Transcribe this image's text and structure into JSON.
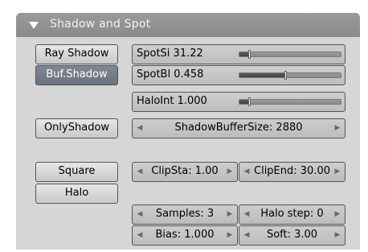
{
  "panel": {
    "title": "Shadow and Spot"
  },
  "buttons": {
    "ray_shadow": "Ray Shadow",
    "buf_shadow": "Buf.Shadow",
    "only_shadow": "OnlyShadow",
    "square": "Square",
    "halo": "Halo"
  },
  "sliders": {
    "spot_si": {
      "label": "SpotSi 31.22",
      "fraction": 0.1
    },
    "spot_bl": {
      "label": "SpotBl 0.458",
      "fraction": 0.46
    },
    "halo_int": {
      "label": "HaloInt 1.000",
      "fraction": 0.1
    }
  },
  "fields": {
    "shadow_buffer_size": "ShadowBufferSize: 2880",
    "clip_sta": "ClipSta: 1.00",
    "clip_end": "ClipEnd: 30.00",
    "samples": "Samples: 3",
    "halo_step": "Halo step: 0",
    "bias": "Bias: 1.000",
    "soft": "Soft: 3.00"
  },
  "icons": {
    "collapse": "triangle-down-icon",
    "decrement": "left-arrow-icon",
    "increment": "right-arrow-icon"
  },
  "colors": {
    "header": "#8f8f8f",
    "panel": "#d6d6d6",
    "active_button": "#737b88"
  }
}
